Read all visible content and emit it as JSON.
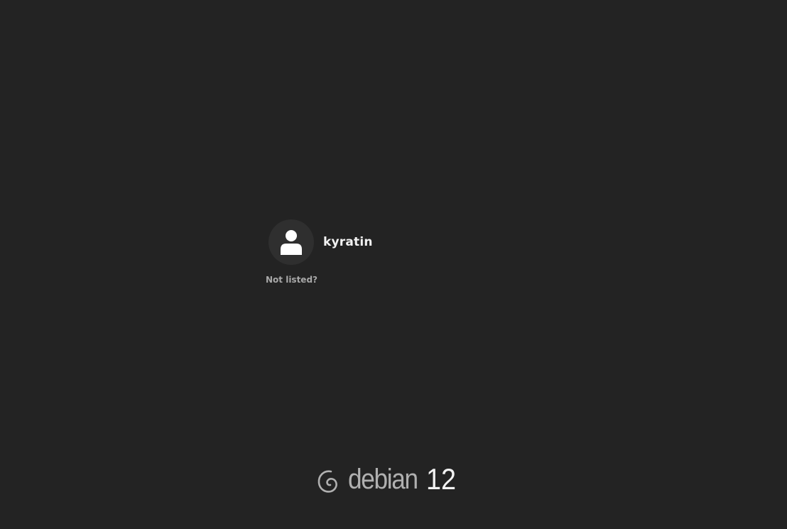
{
  "user_list": {
    "users": [
      {
        "name": "kyratin",
        "avatar_icon": "user-silhouette-icon"
      }
    ],
    "not_listed_label": "Not listed?"
  },
  "branding": {
    "logo_icon": "debian-swirl-icon",
    "distro_name": "debian",
    "version": "12"
  },
  "colors": {
    "background": "#232323",
    "avatar_bg": "#2f2f2f",
    "text_primary": "#f2f2f2",
    "text_secondary": "#a8a8a8",
    "brand_text": "#b0b0b0"
  }
}
